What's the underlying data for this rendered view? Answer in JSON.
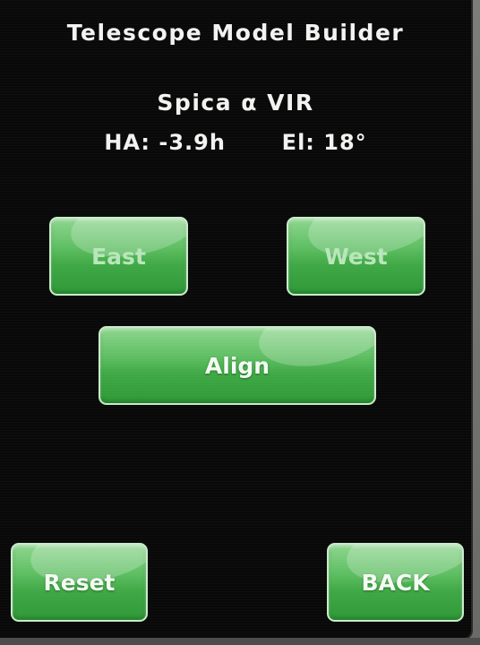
{
  "screen": {
    "title": "Telescope Model Builder",
    "star": "Spica α VIR",
    "hour_angle_label": "HA:",
    "hour_angle_value": "-3.9h",
    "elevation_label": "El:",
    "elevation_value": "18°"
  },
  "buttons": {
    "east": "East",
    "west": "West",
    "align": "Align",
    "reset": "Reset",
    "back": "BACK"
  },
  "colors": {
    "screen_background": "#090909",
    "text": "#f2f2f0",
    "button_green": "#4fb454",
    "button_border": "#c7ecc9"
  }
}
